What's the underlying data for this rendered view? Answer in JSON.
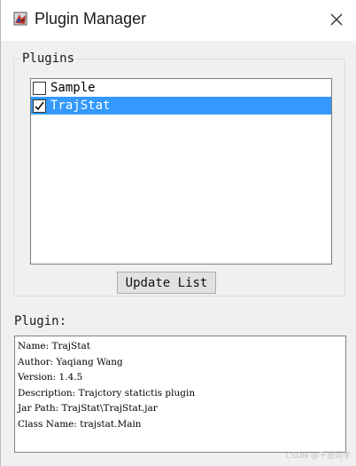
{
  "window": {
    "title": "Plugin Manager",
    "close_icon": "close-icon",
    "app_icon": "plugin-manager-app-icon"
  },
  "plugins_group": {
    "title": "Plugins",
    "items": [
      {
        "label": "Sample",
        "checked": false,
        "selected": false
      },
      {
        "label": "TrajStat",
        "checked": true,
        "selected": true
      }
    ],
    "update_button": "Update List"
  },
  "plugin_info": {
    "label": "Plugin:",
    "lines": [
      "Name: TrajStat",
      "Author: Yaqiang Wang",
      "Version: 1.4.5",
      "Description: Trajctory statictis plugin",
      "Jar Path: TrajStat\\TrajStat.jar",
      "Class Name: trajstat.Main"
    ]
  },
  "watermark": "CSDN @千里同学",
  "colors": {
    "selection": "#3399ff",
    "window_bg": "#f0f0f0"
  }
}
